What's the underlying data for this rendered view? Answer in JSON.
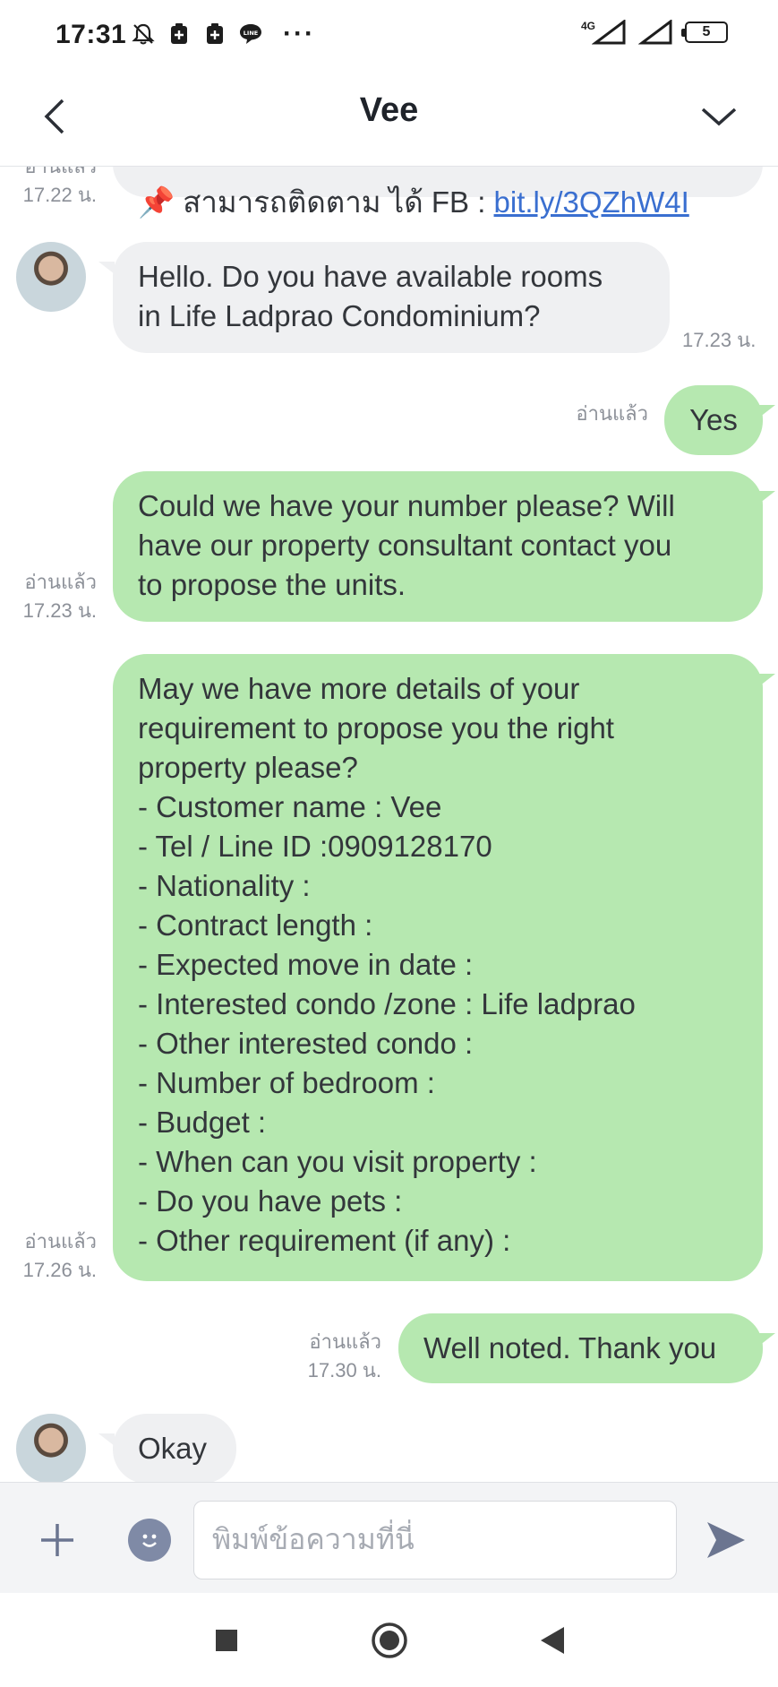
{
  "status_bar": {
    "time": "17:31",
    "network": "4G",
    "battery": "5",
    "more": "···"
  },
  "header": {
    "title": "Vee"
  },
  "messages": {
    "m0": {
      "text": "📌 สามารถติดตาม ได้ FB : ",
      "link": "bit.ly/3QZhW4I",
      "read": "อ่านแล้ว",
      "time": "17.22 น."
    },
    "m1": {
      "text": "Hello. Do you have available rooms\nin Life Ladprao Condominium?",
      "time": "17.23 น."
    },
    "m2": {
      "text": "Yes",
      "read": "อ่านแล้ว"
    },
    "m3": {
      "text": "Could we have your number please? Will\nhave our property consultant contact you\nto propose the units.",
      "read": "อ่านแล้ว",
      "time": "17.23 น."
    },
    "m4": {
      "text": "May we have more details of your\nrequirement to propose you the right\nproperty please?\n- Customer name : Vee\n- Tel / Line ID :0909128170\n- Nationality :\n- Contract length :\n- Expected move in date :\n- Interested condo /zone : Life ladprao\n- Other interested condo :\n- Number of bedroom  :\n- Budget :\n- When can you visit property :\n- Do you have pets :\n- Other requirement (if any) :",
      "read": "อ่านแล้ว",
      "time": "17.26 น."
    },
    "m5": {
      "text": "Well noted. Thank you",
      "read": "อ่านแล้ว",
      "time": "17.30 น."
    },
    "m6": {
      "text": "Okay"
    }
  },
  "input": {
    "placeholder": "พิมพ์ข้อความที่นี่"
  },
  "colors": {
    "outgoing_bubble": "#b6e8b0",
    "incoming_bubble": "#eff0f2",
    "link": "#3a6fd0",
    "meta_text": "#8c9098"
  },
  "icons": {
    "back": "chevron-left-icon",
    "menu": "chevron-down-icon",
    "plus": "plus-icon",
    "emoji": "emoji-icon",
    "send": "send-icon"
  }
}
